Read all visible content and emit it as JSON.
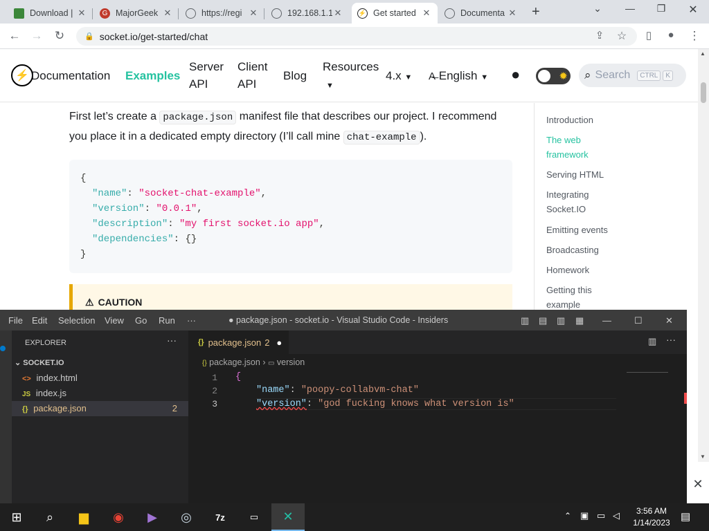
{
  "browser": {
    "tabs": [
      {
        "title": "Download |",
        "icon": "green-hexagon-icon",
        "active": false
      },
      {
        "title": "MajorGeek",
        "icon": "majorgeeks-icon",
        "active": false
      },
      {
        "title": "https://regi",
        "icon": "globe-icon",
        "active": false
      },
      {
        "title": "192.168.1.1",
        "icon": "globe-icon",
        "active": false
      },
      {
        "title": "Get started",
        "icon": "socketio-icon",
        "active": true
      },
      {
        "title": "Documenta",
        "icon": "globe-icon",
        "active": false
      }
    ],
    "url": "socket.io/get-started/chat"
  },
  "site": {
    "nav": {
      "documentation": "Documentation",
      "examples": "Examples",
      "server_api_1": "Server",
      "server_api_2": "API",
      "client_api_1": "Client",
      "client_api_2": "API",
      "blog": "Blog",
      "resources": "Resources",
      "version": "4.x",
      "language": "English",
      "search_placeholder": "Search",
      "search_kbd_1": "CTRL",
      "search_kbd_2": "K"
    },
    "intro_part1": "First let’s create a ",
    "intro_code1": "package.json",
    "intro_part2": " manifest file that describes our project. I recommend you place it in a dedicated empty directory (I’ll call mine ",
    "intro_code2": "chat-example",
    "intro_part3": ").",
    "code_lines": [
      {
        "key": "",
        "value": "",
        "raw": "{"
      },
      {
        "key": "\"name\"",
        "value": "\"socket-chat-example\"",
        "raw": ","
      },
      {
        "key": "\"version\"",
        "value": "\"0.0.1\"",
        "raw": ","
      },
      {
        "key": "\"description\"",
        "value": "\"my first socket.io app\"",
        "raw": ","
      },
      {
        "key": "\"dependencies\"",
        "value": "{}",
        "raw": ""
      },
      {
        "key": "",
        "value": "",
        "raw": "}"
      }
    ],
    "caution": "CAUTION",
    "toc": [
      {
        "label": "Introduction",
        "active": false
      },
      {
        "label": "The web framework",
        "active": true
      },
      {
        "label": "Serving HTML",
        "active": false
      },
      {
        "label": "Integrating Socket.IO",
        "active": false
      },
      {
        "label": "Emitting events",
        "active": false
      },
      {
        "label": "Broadcasting",
        "active": false
      },
      {
        "label": "Homework",
        "active": false
      },
      {
        "label": "Getting this example",
        "active": false
      }
    ]
  },
  "vscode": {
    "menu": [
      "File",
      "Edit",
      "Selection",
      "View",
      "Go",
      "Run",
      "···"
    ],
    "title": "● package.json - socket.io - Visual Studio Code - Insiders",
    "explorer_label": "EXPLORER",
    "folder": "SOCKET.IO",
    "files": [
      {
        "icon": "<>",
        "name": "index.html",
        "badge": "",
        "active": false
      },
      {
        "icon": "JS",
        "name": "index.js",
        "badge": "",
        "active": false
      },
      {
        "icon": "{}",
        "name": "package.json",
        "badge": "2",
        "active": true
      }
    ],
    "tab": {
      "name": "package.json",
      "badge": "2"
    },
    "breadcrumb": {
      "file": "package.json",
      "symbol": "version"
    },
    "lines": [
      {
        "num": "1",
        "text": "{"
      },
      {
        "num": "2",
        "key": "\"name\"",
        "value": "\"poopy-collabvm-chat\""
      },
      {
        "num": "3",
        "key": "\"version\"",
        "value": "\"god fucking knows what version is\""
      }
    ]
  },
  "taskbar": {
    "time": "3:56 AM",
    "date": "1/14/2023"
  }
}
